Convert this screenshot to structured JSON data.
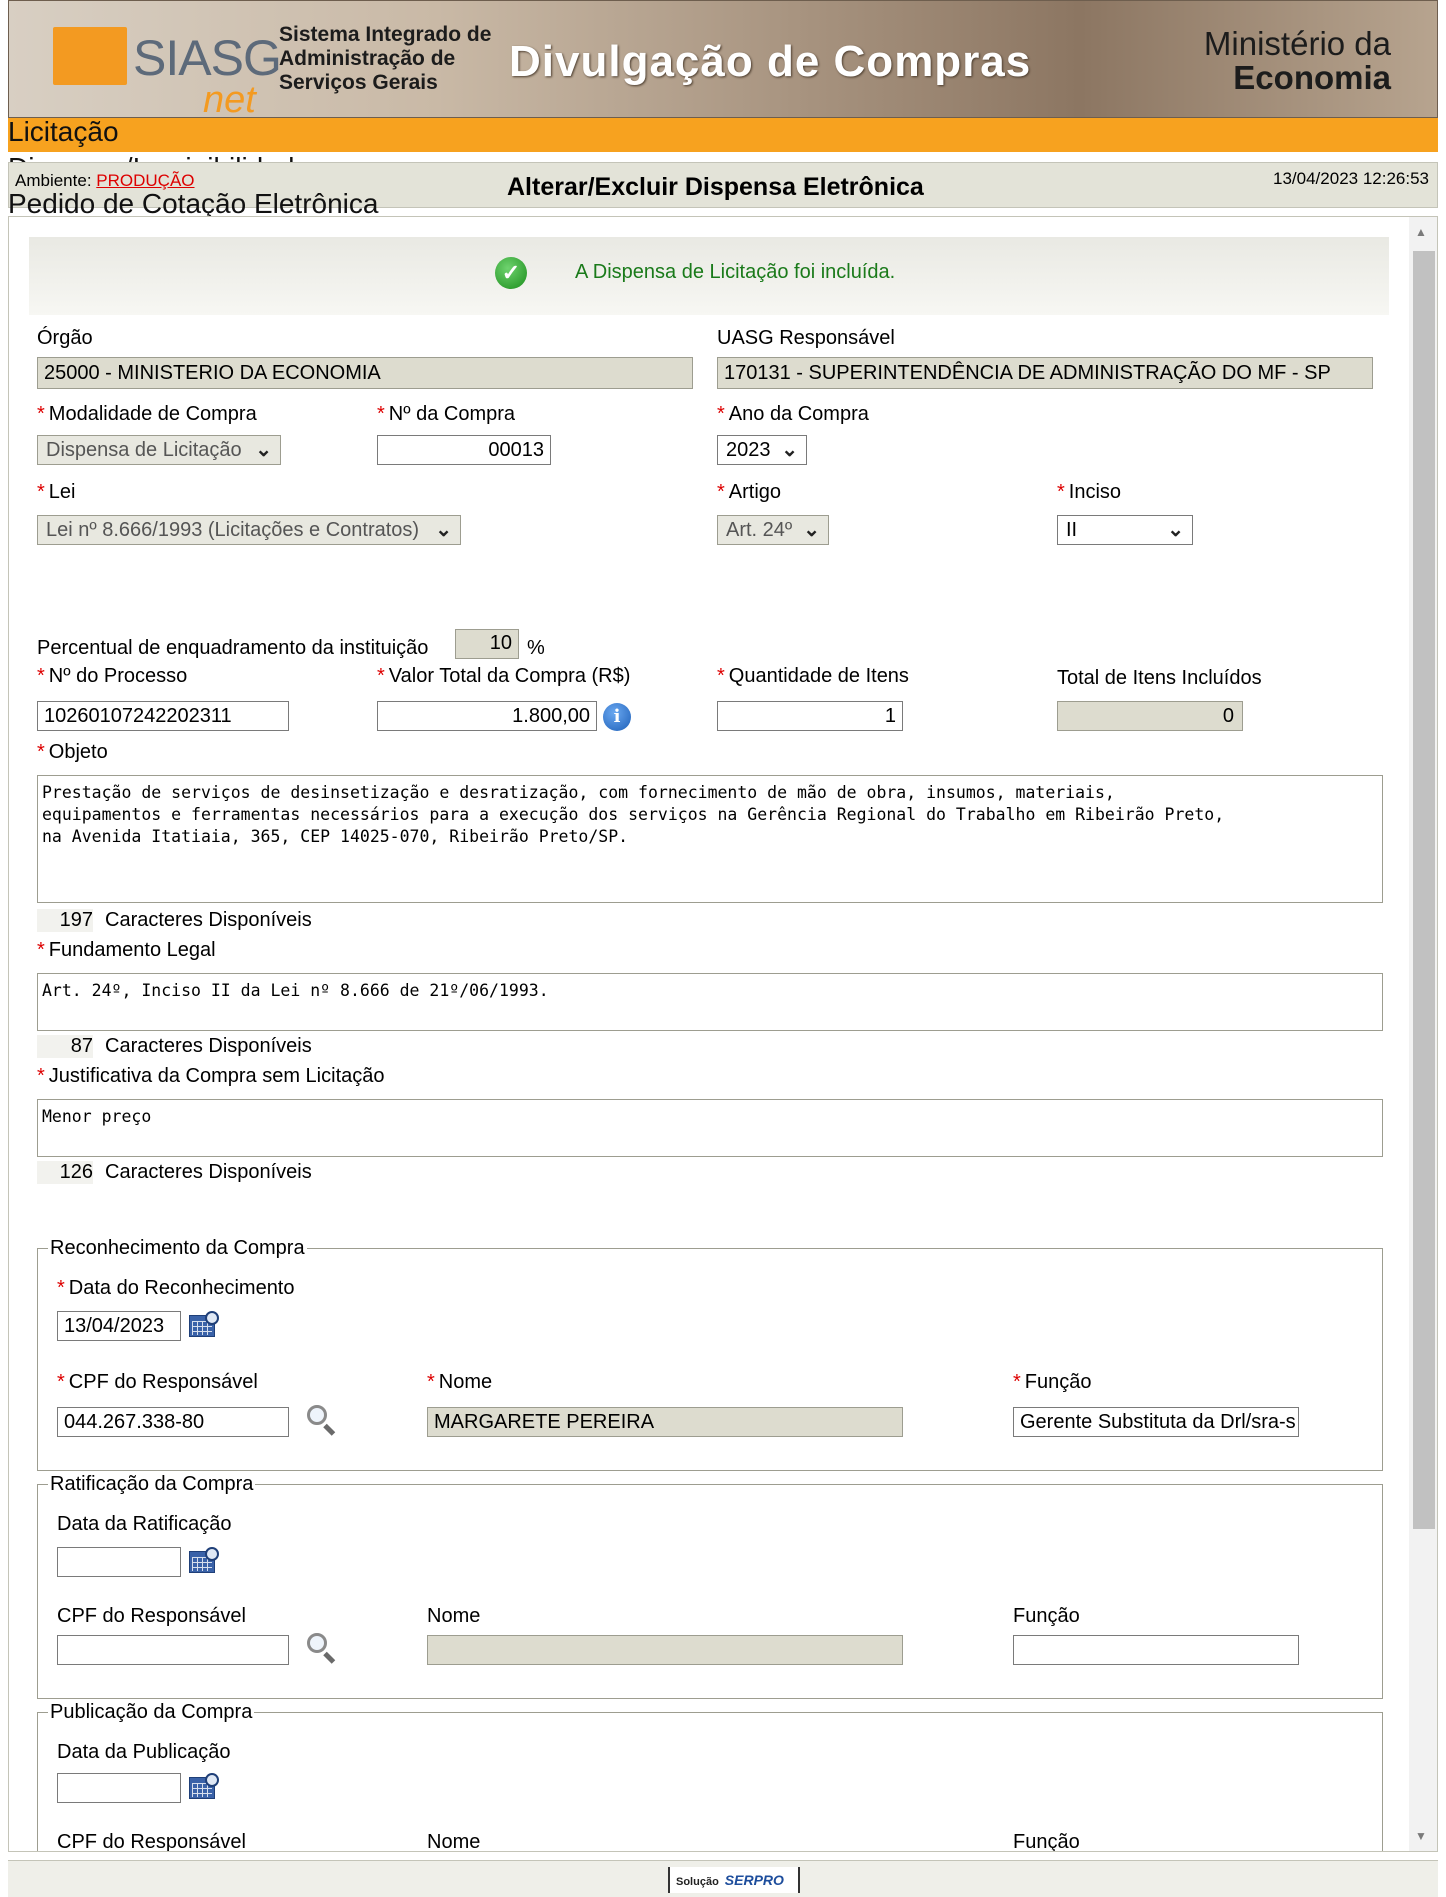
{
  "header": {
    "logo_text": "SIASG",
    "logo_sub": "net",
    "system_name": [
      "Sistema Integrado de",
      "Administração de",
      "Serviços Gerais"
    ],
    "banner_title": "Divulgação de Compras",
    "ministry_line1": "Ministério da",
    "ministry_line2": "Economia"
  },
  "menu": {
    "items": [
      "Licitação",
      "Dispensa/Inexigibilidade",
      "Pedido de Cotação Eletrônica"
    ]
  },
  "env_bar": {
    "env_label": "Ambiente:",
    "env_value": "PRODUÇÃO",
    "title": "Alterar/Excluir Dispensa Eletrônica",
    "datetime": "13/04/2023 12:26:53"
  },
  "message": {
    "text": "A Dispensa de Licitação foi incluída."
  },
  "form": {
    "orgao_label": "Órgão",
    "orgao_value": "25000 - MINISTERIO DA ECONOMIA",
    "uasg_label": "UASG Responsável",
    "uasg_value": "170131 - SUPERINTENDÊNCIA DE ADMINISTRAÇÃO DO MF - SP",
    "modalidade_label": "Modalidade de Compra",
    "modalidade_value": "Dispensa de Licitação",
    "num_compra_label": "Nº da Compra",
    "num_compra_value": "00013",
    "ano_label": "Ano da Compra",
    "ano_value": "2023",
    "lei_label": "Lei",
    "lei_value": "Lei nº 8.666/1993 (Licitações e Contratos)",
    "artigo_label": "Artigo",
    "artigo_value": "Art. 24º",
    "inciso_label": "Inciso",
    "inciso_value": "II",
    "percentual_label": "Percentual de enquadramento da instituição",
    "percentual_value": "10",
    "percentual_unit": "%",
    "processo_label": "Nº do Processo",
    "processo_value": "10260107242202311",
    "valor_label": "Valor Total da Compra (R$)",
    "valor_value": "1.800,00",
    "quantidade_label": "Quantidade de Itens",
    "quantidade_value": "1",
    "total_itens_label": "Total de Itens Incluídos",
    "total_itens_value": "0",
    "objeto_label": "Objeto",
    "objeto_value": "Prestação de serviços de desinsetização e desratização, com fornecimento de mão de obra, insumos, materiais,\nequipamentos e ferramentas necessários para a execução dos serviços na Gerência Regional do Trabalho em Ribeirão Preto,\nna Avenida Itatiaia, 365, CEP 14025-070, Ribeirão Preto/SP.",
    "objeto_chars": "197",
    "chars_label": "Caracteres Disponíveis",
    "fundamento_label": "Fundamento Legal",
    "fundamento_value": "Art. 24º, Inciso II da Lei nº 8.666 de 21º/06/1993.",
    "fundamento_chars": "87",
    "justificativa_label": "Justificativa da Compra sem Licitação",
    "justificativa_value": "Menor preço",
    "justificativa_chars": "126"
  },
  "reconhecimento": {
    "legend": "Reconhecimento da Compra",
    "data_label": "Data do Reconhecimento",
    "data_value": "13/04/2023",
    "cpf_label": "CPF do Responsável",
    "cpf_value": "044.267.338-80",
    "nome_label": "Nome",
    "nome_value": "MARGARETE PEREIRA",
    "funcao_label": "Função",
    "funcao_value": "Gerente Substituta da Drl/sra-s"
  },
  "ratificacao": {
    "legend": "Ratificação da Compra",
    "data_label": "Data da Ratificação",
    "cpf_label": "CPF do Responsável",
    "nome_label": "Nome",
    "funcao_label": "Função"
  },
  "publicacao": {
    "legend": "Publicação da Compra",
    "data_label": "Data da Publicação",
    "cpf_label": "CPF do Responsável",
    "nome_label": "Nome",
    "funcao_label": "Função"
  },
  "footer": {
    "solucao": "Solução",
    "serpro": "SERPRO"
  }
}
